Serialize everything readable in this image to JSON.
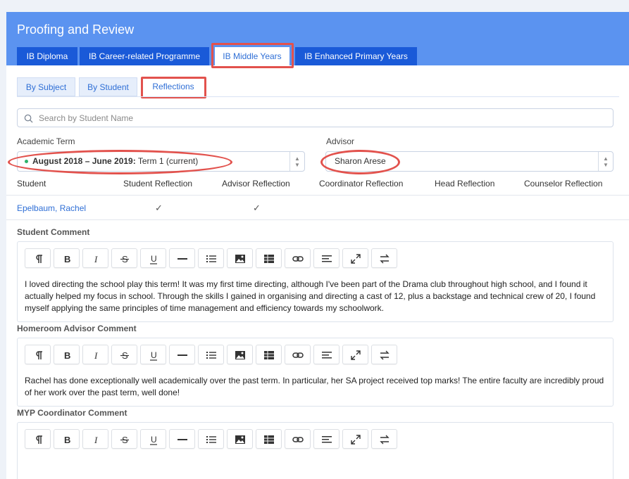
{
  "header": {
    "title": "Proofing and Review",
    "programme_tabs": [
      {
        "label": "IB Diploma"
      },
      {
        "label": "IB Career-related Programme"
      },
      {
        "label": "IB Middle Years"
      },
      {
        "label": "IB Enhanced Primary Years"
      }
    ],
    "active_programme_tab": "IB Middle Years",
    "colors": {
      "header_bg": "#5b93f0",
      "tab_bg": "#1a5ad8",
      "highlight": "#e2524d",
      "link": "#2f6fd6"
    }
  },
  "view_tabs": [
    {
      "label": "By Subject"
    },
    {
      "label": "By Student"
    },
    {
      "label": "Reflections"
    }
  ],
  "active_view_tab": "Reflections",
  "search": {
    "placeholder": "Search by Student Name",
    "value": "",
    "icon": "search-icon"
  },
  "filters": {
    "term_label": "Academic Term",
    "term_value_bold": "August 2018 – June 2019:",
    "term_value_rest": " Term 1 (current)",
    "advisor_label": "Advisor",
    "advisor_value": "Sharon Arese"
  },
  "table": {
    "columns": [
      "Student",
      "Student Reflection",
      "Advisor Reflection",
      "Coordinator Reflection",
      "Head Reflection",
      "Counselor Reflection"
    ],
    "rows": [
      {
        "student": "Epelbaum, Rachel",
        "student_reflection": "✓",
        "advisor_reflection": "✓"
      }
    ]
  },
  "toolbar_icons": [
    "paragraph-icon",
    "bold-icon",
    "italic-icon",
    "strikethrough-icon",
    "underline-icon",
    "horizontal-rule-icon",
    "list-icon",
    "image-icon",
    "table-icon",
    "link-icon",
    "align-icon",
    "fullscreen-icon",
    "swap-icon"
  ],
  "comments": [
    {
      "label": "Student Comment",
      "text": "I loved directing the school play this term! It was my first time directing, although I've been part of the Drama club throughout high school, and I found it actually helped my focus in school. Through the skills I gained in organising and directing a cast of 12, plus a backstage and technical crew of 20, I found myself applying the same principles of time management and efficiency towards my schoolwork."
    },
    {
      "label": "Homeroom Advisor Comment",
      "text": "Rachel has done exceptionally well academically over the past term. In particular, her SA project received top marks! The entire faculty are incredibly proud of her work over the past term, well done!"
    },
    {
      "label": "MYP Coordinator Comment",
      "text": ""
    }
  ]
}
